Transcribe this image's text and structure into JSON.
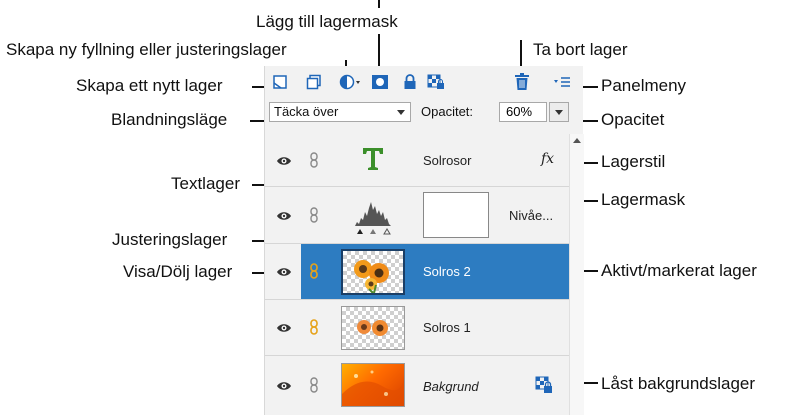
{
  "callouts": {
    "add_layer_mask": "Lägg till lagermask",
    "new_fill_adjustment": "Skapa ny fyllning eller justeringslager",
    "delete_layer": "Ta bort lager",
    "new_layer": "Skapa ett nytt lager",
    "panel_menu": "Panelmeny",
    "blend_mode": "Blandningsläge",
    "opacity": "Opacitet",
    "layer_style": "Lagerstil",
    "text_layer": "Textlager",
    "layer_mask": "Lagermask",
    "adjustment_layer": "Justeringslager",
    "show_hide": "Visa/Dölj lager",
    "active_layer": "Aktivt/markerat lager",
    "locked_background": "Låst bakgrundslager"
  },
  "options": {
    "blend_mode_value": "Täcka över",
    "opacity_label": "Opacitet:",
    "opacity_value": "60%"
  },
  "layers": [
    {
      "name": "Solrosor",
      "type": "text",
      "fx": "fx"
    },
    {
      "name": "Nivåe...",
      "type": "adjustment"
    },
    {
      "name": "Solros 2",
      "type": "image",
      "active": true
    },
    {
      "name": "Solros 1",
      "type": "image"
    },
    {
      "name": "Bakgrund",
      "type": "background",
      "locked": true
    }
  ],
  "colors": {
    "active_row": "#2d7cc1",
    "toolbar_blue": "#1f66b8",
    "text_icon_green": "#3b8f2a",
    "link_gold": "#e6a218"
  }
}
